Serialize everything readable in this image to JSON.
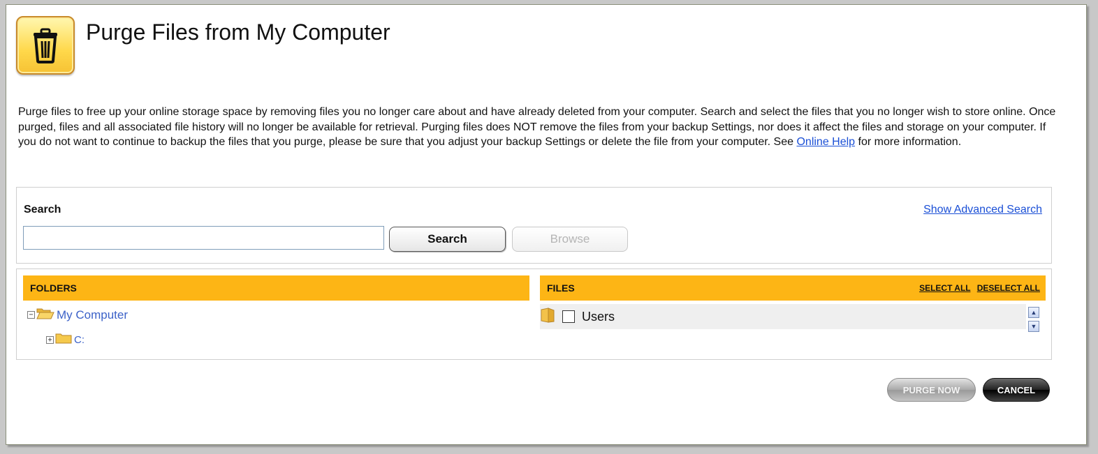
{
  "page_title": "Purge Files from My Computer",
  "description": {
    "text_before_link": "Purge files to free up your online storage space by removing files you no longer care about and have already deleted from your computer. Search and select the files that you no longer wish to store online. Once purged, files and all associated file history will no longer be available for retrieval. Purging files does NOT remove the files from your backup Settings, nor does it affect the files and storage on your computer. If you do not want to continue to backup the files that you purge, please be sure that you adjust your backup Settings or delete the file from your computer. See ",
    "link_text": "Online Help",
    "text_after_link": " for more information."
  },
  "search": {
    "label": "Search",
    "advanced_link": "Show Advanced Search",
    "input_value": "",
    "search_button": "Search",
    "browse_button": "Browse"
  },
  "folders": {
    "header": "FOLDERS",
    "tree": [
      {
        "label": "My Computer",
        "expanded": true,
        "expander": "−"
      },
      {
        "label": "C:",
        "expanded": false,
        "expander": "+"
      }
    ]
  },
  "files": {
    "header": "FILES",
    "select_all": "SELECT ALL",
    "deselect_all": "DESELECT ALL",
    "items": [
      {
        "name": "Users",
        "checked": false
      }
    ]
  },
  "actions": {
    "purge_now": "PURGE NOW",
    "cancel": "CANCEL"
  },
  "colors": {
    "accent_header": "#fdb515",
    "link": "#1a4fd6",
    "tree_link": "#3c62c8"
  }
}
